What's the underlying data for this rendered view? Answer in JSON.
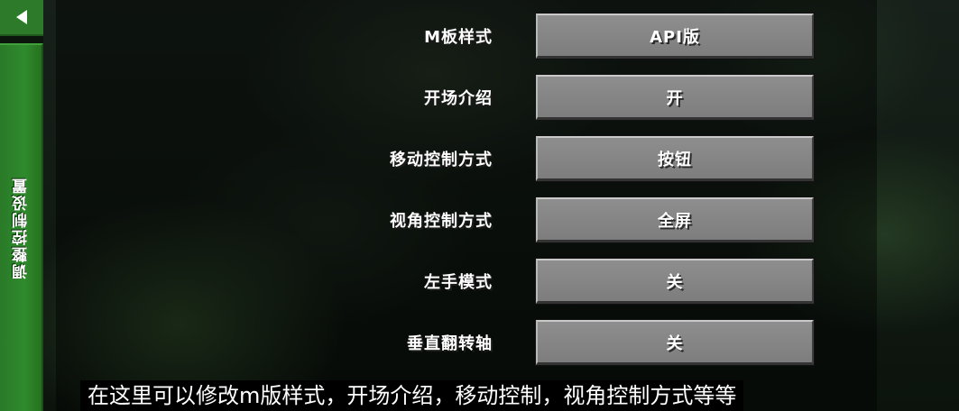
{
  "sidebar": {
    "tab_label": "调整控制设置"
  },
  "settings": [
    {
      "label": "M板样式",
      "value": "API版"
    },
    {
      "label": "开场介绍",
      "value": "开"
    },
    {
      "label": "移动控制方式",
      "value": "按钮"
    },
    {
      "label": "视角控制方式",
      "value": "全屏"
    },
    {
      "label": "左手模式",
      "value": "关"
    },
    {
      "label": "垂直翻转轴",
      "value": "关"
    }
  ],
  "subtitle": "在这里可以修改m版样式，开场介绍，移动控制，视角控制方式等等",
  "colors": {
    "accent_green": "#2f8a2d",
    "button_gray": "#8e8e8e"
  }
}
